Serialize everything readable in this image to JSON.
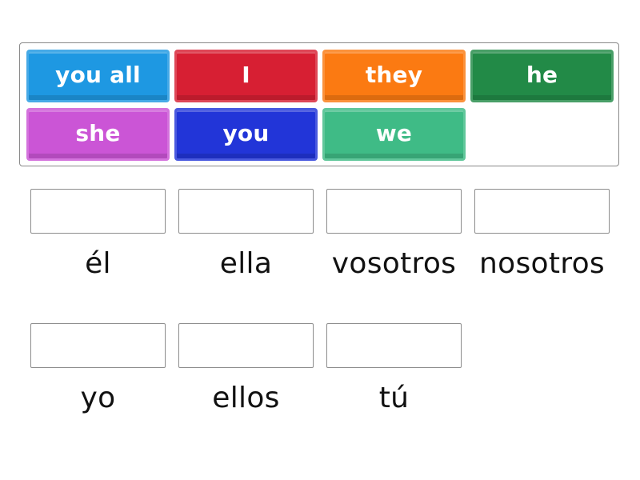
{
  "tiles": [
    {
      "label": "you all",
      "color": "#1e98e2"
    },
    {
      "label": "I",
      "color": "#d71f33"
    },
    {
      "label": "they",
      "color": "#fb7a12"
    },
    {
      "label": "he",
      "color": "#228a47"
    },
    {
      "label": "she",
      "color": "#cb55d6"
    },
    {
      "label": "you",
      "color": "#2235d8"
    },
    {
      "label": "we",
      "color": "#3fbb86"
    }
  ],
  "targets": [
    {
      "label": "él",
      "answer": ""
    },
    {
      "label": "ella",
      "answer": ""
    },
    {
      "label": "vosotros",
      "answer": ""
    },
    {
      "label": "nosotros",
      "answer": ""
    },
    {
      "label": "yo",
      "answer": ""
    },
    {
      "label": "ellos",
      "answer": ""
    },
    {
      "label": "tú",
      "answer": ""
    }
  ]
}
